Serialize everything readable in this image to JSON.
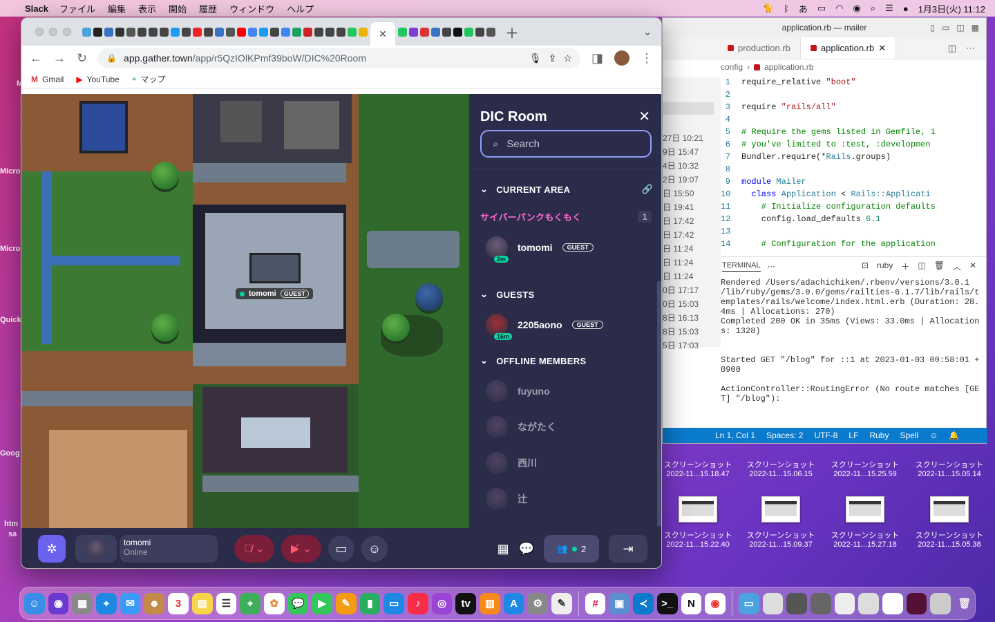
{
  "menubar": {
    "app": "Slack",
    "items": [
      "ファイル",
      "編集",
      "表示",
      "開始",
      "履歴",
      "ウィンドウ",
      "ヘルプ"
    ],
    "clock": "1月3日(火)  11:12"
  },
  "desktop_left_labels": [
    "M",
    "Micro",
    "Micro",
    "Quick",
    "Goog",
    "htm",
    "sa"
  ],
  "desktop_files": [
    {
      "l1": "スクリーンショット",
      "l2": "2022-11...15.18.47"
    },
    {
      "l1": "スクリーンショット",
      "l2": "2022-11...15.06.15"
    },
    {
      "l1": "スクリーンショット",
      "l2": "2022-11...15.25.59"
    },
    {
      "l1": "スクリーンショット",
      "l2": "2022-11...15.05.14"
    },
    {
      "l1": "スクリーンショット",
      "l2": "2022-11...15.22.40"
    },
    {
      "l1": "スクリーンショット",
      "l2": "2022-11...15.09.37"
    },
    {
      "l1": "スクリーンショット",
      "l2": "2022-11...15.27.18"
    },
    {
      "l1": "スクリーンショット",
      "l2": "2022-11...15.05.38"
    }
  ],
  "vscode": {
    "title": "application.rb — mailer",
    "tabs": [
      "production.rb",
      "application.rb"
    ],
    "breadcrumb_1": "config",
    "breadcrumb_2": "application.rb",
    "list_times": [
      "27日 10:21",
      "9日 15:47",
      "4日 10:32",
      "2日 19:07",
      "日 15:50",
      "日 19:41",
      "日 17:42",
      "日 17:42",
      "日 11:24",
      "日 11:24",
      "日 11:24",
      "0日 17:17",
      "0日 15:03",
      "8日 16:13",
      "8日 15:03",
      "5日 17:03"
    ],
    "terminal_tab": "TERMINAL",
    "terminal_shell": "ruby",
    "terminal_text": "Rendered /Users/adachichiken/.rbenv/versions/3.0.1\n/lib/ruby/gems/3.0.0/gems/railties-6.1.7/lib/rails/t\nemplates/rails/welcome/index.html.erb (Duration: 28.\n4ms | Allocations: 270)\nCompleted 200 OK in 35ms (Views: 33.0ms | Allocation\ns: 1328)\n\n\nStarted GET \"/blog\" for ::1 at 2023-01-03 00:58:01 +\n0900\n\nActionController::RoutingError (No route matches [GE\nT] \"/blog\"):\n\n",
    "status": [
      "Ln 1, Col 1",
      "Spaces: 2",
      "UTF-8",
      "LF",
      "Ruby",
      "Spell"
    ]
  },
  "chrome": {
    "url_host": "app.gather.town",
    "url_path": "/app/r5QzIOlKPmf39boW/DIC%20Room",
    "bookmarks": [
      "Gmail",
      "YouTube",
      "マップ"
    ]
  },
  "map": {
    "nametag": "tomomi",
    "nametag_badge": "GUEST"
  },
  "panel": {
    "title": "DIC Room",
    "search_placeholder": "Search",
    "current_area_label": "CURRENT AREA",
    "area_name": "サイバーパンクもくもく",
    "area_count": "1",
    "area_member": {
      "name": "tomomi",
      "badge": "GUEST",
      "time": "2m"
    },
    "guests_label": "GUESTS",
    "guest_member": {
      "name": "2205aono",
      "badge": "GUEST",
      "time": "16m"
    },
    "offline_label": "OFFLINE MEMBERS",
    "offline_members": [
      "fuyuno",
      "ながたく",
      "西川",
      "辻"
    ]
  },
  "bottombar": {
    "user_name": "tomomi",
    "user_status": "Online",
    "participants_count": "2"
  },
  "colors": {
    "accent": "#8fa0ff",
    "panel_bg": "#2b2b4a",
    "area_pink": "#ff6ad5",
    "online_green": "#06d6a0",
    "vscode_status": "#0a7acc"
  }
}
